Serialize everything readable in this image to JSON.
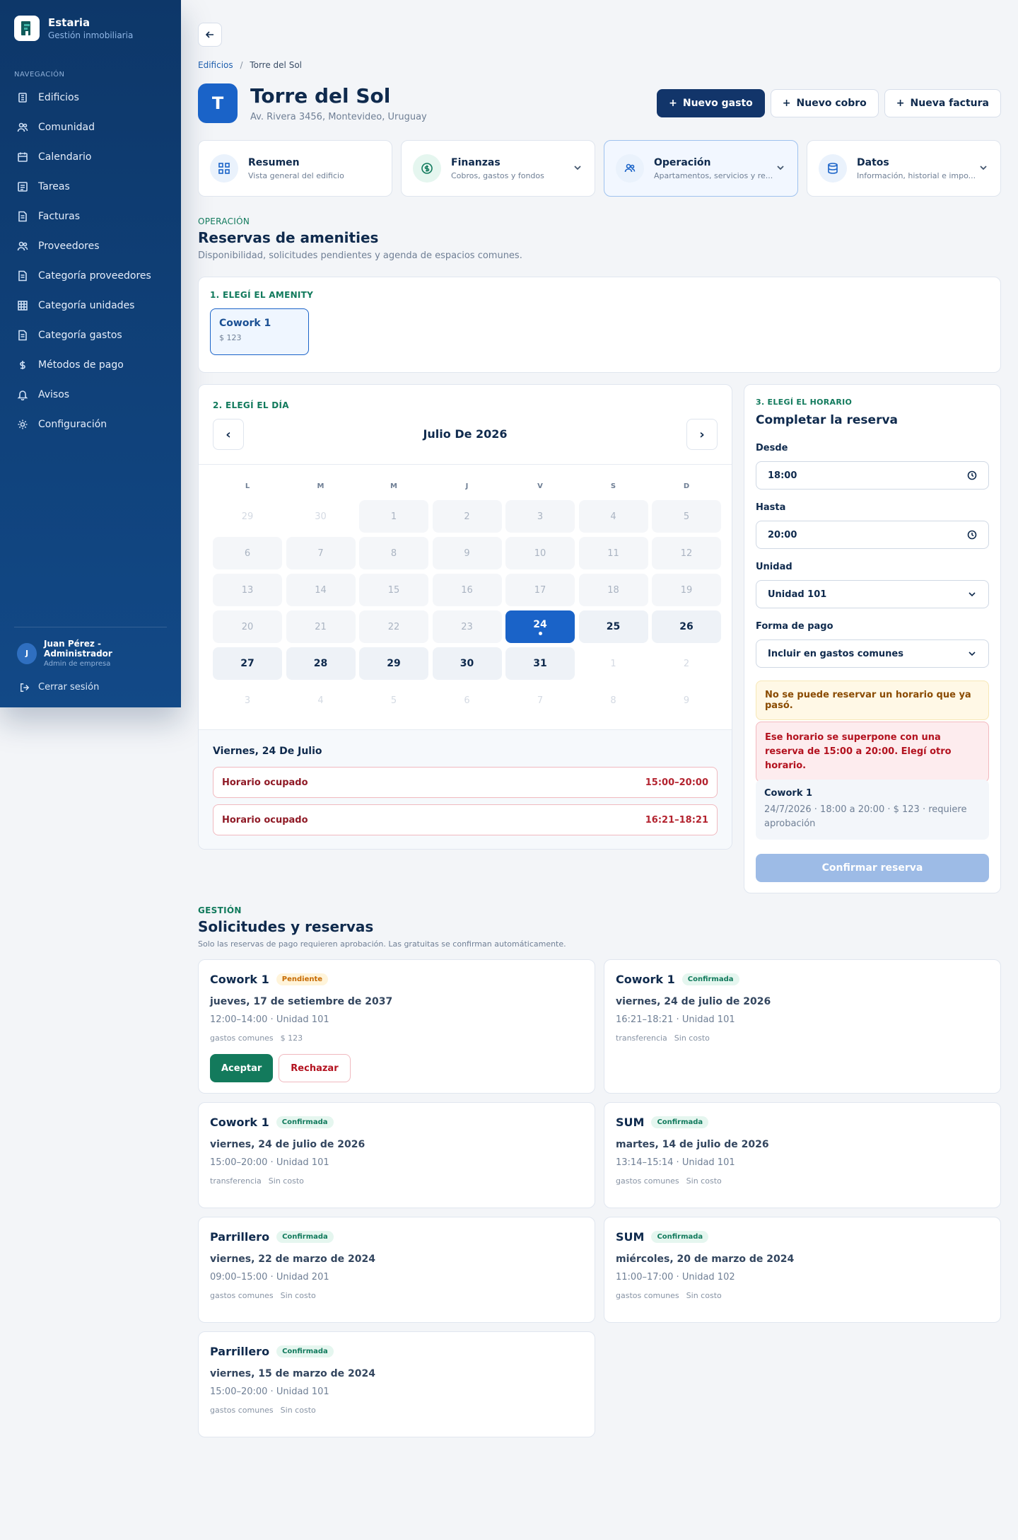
{
  "brand": {
    "name": "Estaria",
    "subtitle": "Gestión inmobiliaria"
  },
  "sidebar": {
    "heading": "NAVEGACIÓN",
    "items": [
      {
        "label": "Edificios",
        "icon": "building-icon"
      },
      {
        "label": "Comunidad",
        "icon": "users-icon"
      },
      {
        "label": "Calendario",
        "icon": "calendar-icon"
      },
      {
        "label": "Tareas",
        "icon": "tasks-icon"
      },
      {
        "label": "Facturas",
        "icon": "invoice-icon"
      },
      {
        "label": "Proveedores",
        "icon": "users-icon"
      },
      {
        "label": "Categoría proveedores",
        "icon": "document-icon"
      },
      {
        "label": "Categoría unidades",
        "icon": "grid-icon"
      },
      {
        "label": "Categoría gastos",
        "icon": "document-icon"
      },
      {
        "label": "Métodos de pago",
        "icon": "dollar-icon"
      },
      {
        "label": "Avisos",
        "icon": "bell-icon"
      },
      {
        "label": "Configuración",
        "icon": "gear-icon"
      }
    ],
    "user": {
      "initial": "J",
      "name": "Juan Pérez - Administrador",
      "role": "Admin de empresa"
    },
    "logout": "Cerrar sesión"
  },
  "breadcrumb": {
    "parent": "Edificios",
    "separator": "/",
    "current": "Torre del Sol"
  },
  "building": {
    "initial": "T",
    "name": "Torre del Sol",
    "address": "Av. Rivera 3456, Montevideo, Uruguay"
  },
  "actions": {
    "new_expense": "Nuevo gasto",
    "new_charge": "Nuevo cobro",
    "new_invoice": "Nueva factura"
  },
  "tabs": [
    {
      "title": "Resumen",
      "subtitle": "Vista general del edificio"
    },
    {
      "title": "Finanzas",
      "subtitle": "Cobros, gastos y fondos"
    },
    {
      "title": "Operación",
      "subtitle": "Apartamentos, servicios y re..."
    },
    {
      "title": "Datos",
      "subtitle": "Información, historial e impo..."
    }
  ],
  "section": {
    "eyebrow": "OPERACIÓN",
    "title": "Reservas de amenities",
    "subtitle": "Disponibilidad, solicitudes pendientes y agenda de espacios comunes."
  },
  "step1": {
    "label": "1. ELEGÍ EL AMENITY",
    "amenity_name": "Cowork 1",
    "amenity_price": "$ 123"
  },
  "calendar": {
    "label": "2. ELEGÍ EL DÍA",
    "month": "Julio De 2026",
    "prev": "‹",
    "next": "›",
    "weekdays": [
      "L",
      "M",
      "M",
      "J",
      "V",
      "S",
      "D"
    ],
    "days": [
      {
        "n": "29",
        "s": "out"
      },
      {
        "n": "30",
        "s": "out"
      },
      {
        "n": "1",
        "s": "dis"
      },
      {
        "n": "2",
        "s": "dis"
      },
      {
        "n": "3",
        "s": "dis"
      },
      {
        "n": "4",
        "s": "dis"
      },
      {
        "n": "5",
        "s": "dis"
      },
      {
        "n": "6",
        "s": "dis"
      },
      {
        "n": "7",
        "s": "dis"
      },
      {
        "n": "8",
        "s": "dis"
      },
      {
        "n": "9",
        "s": "dis"
      },
      {
        "n": "10",
        "s": "dis"
      },
      {
        "n": "11",
        "s": "dis"
      },
      {
        "n": "12",
        "s": "dis"
      },
      {
        "n": "13",
        "s": "dis"
      },
      {
        "n": "14",
        "s": "dis"
      },
      {
        "n": "15",
        "s": "dis"
      },
      {
        "n": "16",
        "s": "dis"
      },
      {
        "n": "17",
        "s": "dis"
      },
      {
        "n": "18",
        "s": "dis"
      },
      {
        "n": "19",
        "s": "dis"
      },
      {
        "n": "20",
        "s": "dis"
      },
      {
        "n": "21",
        "s": "dis"
      },
      {
        "n": "22",
        "s": "dis"
      },
      {
        "n": "23",
        "s": "dis"
      },
      {
        "n": "24",
        "s": "sel"
      },
      {
        "n": "25",
        "s": "av"
      },
      {
        "n": "26",
        "s": "av"
      },
      {
        "n": "27",
        "s": "av"
      },
      {
        "n": "28",
        "s": "av"
      },
      {
        "n": "29",
        "s": "av"
      },
      {
        "n": "30",
        "s": "av"
      },
      {
        "n": "31",
        "s": "av"
      },
      {
        "n": "1",
        "s": "out"
      },
      {
        "n": "2",
        "s": "out"
      },
      {
        "n": "3",
        "s": "out"
      },
      {
        "n": "4",
        "s": "out"
      },
      {
        "n": "5",
        "s": "out"
      },
      {
        "n": "6",
        "s": "out"
      },
      {
        "n": "7",
        "s": "out"
      },
      {
        "n": "8",
        "s": "out"
      },
      {
        "n": "9",
        "s": "out"
      }
    ],
    "selected_day_title": "Viernes, 24 De Julio",
    "slots": [
      {
        "label": "Horario ocupado",
        "time": "15:00–20:00"
      },
      {
        "label": "Horario ocupado",
        "time": "16:21–18:21"
      }
    ]
  },
  "form": {
    "label": "3. ELEGÍ EL HORARIO",
    "title": "Completar la reserva",
    "from_label": "Desde",
    "from_value": "18:00",
    "to_label": "Hasta",
    "to_value": "20:00",
    "unit_label": "Unidad",
    "unit_value": "Unidad 101",
    "payment_label": "Forma de pago",
    "payment_value": "Incluir en gastos comunes",
    "warning": "No se puede reservar un horario que ya pasó.",
    "error": "Ese horario se superpone con una reserva de 15:00 a 20:00. Elegí otro horario.",
    "summary_name": "Cowork 1",
    "summary_detail": "24/7/2026 · 18:00 a 20:00 · $ 123 · requiere aprobación",
    "confirm": "Confirmar reserva"
  },
  "management": {
    "eyebrow": "GESTIÓN",
    "title": "Solicitudes y reservas",
    "subtitle": "Solo las reservas de pago requieren aprobación. Las gratuitas se confirman automáticamente.",
    "accept": "Aceptar",
    "reject": "Rechazar",
    "reservations": [
      {
        "name": "Cowork 1",
        "status": "Pendiente",
        "date": "jueves, 17 de setiembre de 2037",
        "time": "12:00–14:00 · Unidad 101",
        "method": "gastos comunes",
        "cost": "$ 123"
      },
      {
        "name": "Cowork 1",
        "status": "Confirmada",
        "date": "viernes, 24 de julio de 2026",
        "time": "16:21–18:21 · Unidad 101",
        "method": "transferencia",
        "cost": "Sin costo"
      },
      {
        "name": "Cowork 1",
        "status": "Confirmada",
        "date": "viernes, 24 de julio de 2026",
        "time": "15:00–20:00 · Unidad 101",
        "method": "transferencia",
        "cost": "Sin costo"
      },
      {
        "name": "SUM",
        "status": "Confirmada",
        "date": "martes, 14 de julio de 2026",
        "time": "13:14–15:14 · Unidad 101",
        "method": "gastos comunes",
        "cost": "Sin costo"
      },
      {
        "name": "Parrillero",
        "status": "Confirmada",
        "date": "viernes, 22 de marzo de 2024",
        "time": "09:00–15:00 · Unidad 201",
        "method": "gastos comunes",
        "cost": "Sin costo"
      },
      {
        "name": "SUM",
        "status": "Confirmada",
        "date": "miércoles, 20 de marzo de 2024",
        "time": "11:00–17:00 · Unidad 102",
        "method": "gastos comunes",
        "cost": "Sin costo"
      },
      {
        "name": "Parrillero",
        "status": "Confirmada",
        "date": "viernes, 15 de marzo de 2024",
        "time": "15:00–20:00 · Unidad 101",
        "method": "gastos comunes",
        "cost": "Sin costo"
      }
    ]
  }
}
